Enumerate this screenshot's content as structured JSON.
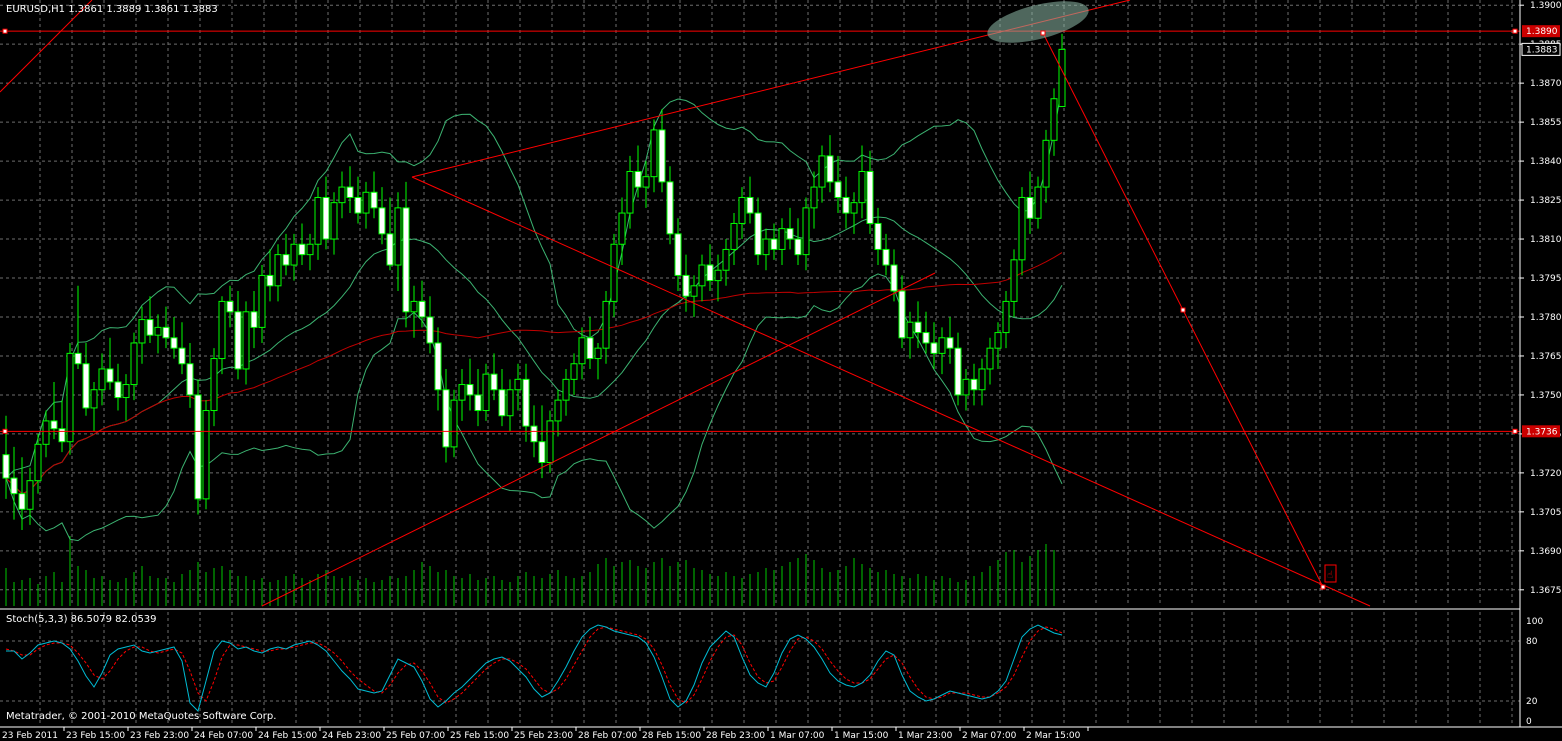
{
  "header": {
    "symbol_info": "EURUSD,H1  1.3861 1.3889 1.3861 1.3883"
  },
  "indicator": {
    "label": "Stoch(5,3,3) 86.5079 82.0539"
  },
  "footer": {
    "copyright": "Metatrader, © 2001-2010 MetaQuotes Software Corp."
  },
  "colors": {
    "background": "#000000",
    "grid": "#6e6e6e",
    "candle_up": "#000000",
    "candle_down": "#ffffff",
    "wick": "#00ff00",
    "bands": "#3cb371",
    "ma": "#c00000",
    "trendline": "#ff0000",
    "stoch_main": "#00bcd4",
    "stoch_signal": "#ff0000",
    "label_highlight": "#cc0000"
  },
  "price_axis": {
    "ticks": [
      "1.3900",
      "1.3885",
      "1.3870",
      "1.3855",
      "1.3840",
      "1.3825",
      "1.3810",
      "1.3795",
      "1.3780",
      "1.3765",
      "1.3750",
      "1.3735",
      "1.3720",
      "1.3705",
      "1.3690",
      "1.3675"
    ],
    "current_price_label": "1.3883",
    "hline_upper_label": "1.3890",
    "hline_lower_label": "1.3736"
  },
  "stoch_axis": {
    "ticks": [
      "100",
      "80",
      "20",
      "0"
    ]
  },
  "time_axis": {
    "labels": [
      "23 Feb 2011",
      "23 Feb 15:00",
      "23 Feb 23:00",
      "24 Feb 07:00",
      "24 Feb 15:00",
      "24 Feb 23:00",
      "25 Feb 07:00",
      "25 Feb 15:00",
      "25 Feb 23:00",
      "28 Feb 07:00",
      "28 Feb 15:00",
      "28 Feb 23:00",
      "1 Mar 07:00",
      "1 Mar 15:00",
      "1 Mar 23:00",
      "2 Mar 07:00",
      "2 Mar 15:00"
    ]
  },
  "chart_data": {
    "type": "candlestick",
    "symbol": "EURUSD",
    "timeframe": "H1",
    "last": {
      "open": 1.3861,
      "high": 1.3889,
      "low": 1.3861,
      "close": 1.3883
    },
    "ylim": [
      1.3668,
      1.3902
    ],
    "horizontal_lines": [
      1.389,
      1.3736
    ],
    "candles": [
      [
        1.3727,
        1.3742,
        1.371,
        1.3718
      ],
      [
        1.3718,
        1.373,
        1.3702,
        1.3712
      ],
      [
        1.3712,
        1.3726,
        1.3698,
        1.3706
      ],
      [
        1.3706,
        1.3722,
        1.37,
        1.3717
      ],
      [
        1.3717,
        1.3735,
        1.3712,
        1.3731
      ],
      [
        1.3731,
        1.3744,
        1.3726,
        1.374
      ],
      [
        1.374,
        1.3755,
        1.3733,
        1.3737
      ],
      [
        1.3737,
        1.3748,
        1.3728,
        1.3732
      ],
      [
        1.3732,
        1.377,
        1.3727,
        1.3766
      ],
      [
        1.3766,
        1.3792,
        1.376,
        1.3762
      ],
      [
        1.3762,
        1.377,
        1.3742,
        1.3745
      ],
      [
        1.3745,
        1.3755,
        1.3736,
        1.3752
      ],
      [
        1.3752,
        1.3766,
        1.3746,
        1.376
      ],
      [
        1.376,
        1.3772,
        1.3752,
        1.3755
      ],
      [
        1.3755,
        1.3762,
        1.3744,
        1.3749
      ],
      [
        1.3749,
        1.3758,
        1.374,
        1.3754
      ],
      [
        1.3754,
        1.3774,
        1.3748,
        1.377
      ],
      [
        1.377,
        1.3784,
        1.3762,
        1.3779
      ],
      [
        1.3779,
        1.3788,
        1.377,
        1.3773
      ],
      [
        1.3773,
        1.3781,
        1.3766,
        1.3776
      ],
      [
        1.3776,
        1.3784,
        1.3768,
        1.3772
      ],
      [
        1.3772,
        1.378,
        1.3764,
        1.3768
      ],
      [
        1.3768,
        1.3778,
        1.3758,
        1.3762
      ],
      [
        1.3762,
        1.377,
        1.3745,
        1.375
      ],
      [
        1.375,
        1.3756,
        1.3704,
        1.371
      ],
      [
        1.371,
        1.3748,
        1.3706,
        1.3744
      ],
      [
        1.3744,
        1.3768,
        1.3738,
        1.3764
      ],
      [
        1.3764,
        1.3788,
        1.3758,
        1.3786
      ],
      [
        1.3786,
        1.3792,
        1.3776,
        1.3782
      ],
      [
        1.3782,
        1.379,
        1.3756,
        1.376
      ],
      [
        1.376,
        1.3786,
        1.3754,
        1.3782
      ],
      [
        1.3782,
        1.379,
        1.3768,
        1.3776
      ],
      [
        1.3776,
        1.38,
        1.377,
        1.3796
      ],
      [
        1.3796,
        1.3806,
        1.3786,
        1.3792
      ],
      [
        1.3792,
        1.3808,
        1.3786,
        1.3804
      ],
      [
        1.3804,
        1.3812,
        1.3796,
        1.38
      ],
      [
        1.38,
        1.3812,
        1.3794,
        1.3808
      ],
      [
        1.3808,
        1.3816,
        1.38,
        1.3804
      ],
      [
        1.3804,
        1.3812,
        1.3798,
        1.3808
      ],
      [
        1.3808,
        1.383,
        1.3802,
        1.3826
      ],
      [
        1.3826,
        1.3834,
        1.3806,
        1.381
      ],
      [
        1.381,
        1.3828,
        1.3804,
        1.3824
      ],
      [
        1.3824,
        1.3836,
        1.3818,
        1.383
      ],
      [
        1.383,
        1.3838,
        1.382,
        1.3826
      ],
      [
        1.3826,
        1.3834,
        1.3816,
        1.382
      ],
      [
        1.382,
        1.3832,
        1.3814,
        1.3828
      ],
      [
        1.3828,
        1.3836,
        1.3818,
        1.3822
      ],
      [
        1.3822,
        1.383,
        1.3808,
        1.3812
      ],
      [
        1.3812,
        1.3826,
        1.3798,
        1.38
      ],
      [
        1.38,
        1.3828,
        1.379,
        1.3822
      ],
      [
        1.3822,
        1.3832,
        1.3776,
        1.3782
      ],
      [
        1.3782,
        1.3792,
        1.3772,
        1.3786
      ],
      [
        1.3786,
        1.3794,
        1.3776,
        1.378
      ],
      [
        1.378,
        1.3788,
        1.3766,
        1.377
      ],
      [
        1.377,
        1.3776,
        1.3744,
        1.3752
      ],
      [
        1.3752,
        1.376,
        1.3724,
        1.373
      ],
      [
        1.373,
        1.3752,
        1.3726,
        1.3748
      ],
      [
        1.3748,
        1.376,
        1.374,
        1.3754
      ],
      [
        1.3754,
        1.3764,
        1.3744,
        1.375
      ],
      [
        1.375,
        1.376,
        1.3738,
        1.3744
      ],
      [
        1.3744,
        1.3762,
        1.374,
        1.3758
      ],
      [
        1.3758,
        1.3766,
        1.3748,
        1.3752
      ],
      [
        1.3752,
        1.376,
        1.3738,
        1.3742
      ],
      [
        1.3742,
        1.3756,
        1.3736,
        1.3752
      ],
      [
        1.3752,
        1.3762,
        1.3744,
        1.3756
      ],
      [
        1.3756,
        1.3762,
        1.3732,
        1.3738
      ],
      [
        1.3738,
        1.3746,
        1.3726,
        1.3732
      ],
      [
        1.3732,
        1.3746,
        1.3718,
        1.3724
      ],
      [
        1.3724,
        1.3744,
        1.372,
        1.374
      ],
      [
        1.374,
        1.3752,
        1.3734,
        1.3748
      ],
      [
        1.3748,
        1.376,
        1.3742,
        1.3756
      ],
      [
        1.3756,
        1.3766,
        1.375,
        1.3762
      ],
      [
        1.3762,
        1.3776,
        1.3756,
        1.3772
      ],
      [
        1.3772,
        1.378,
        1.376,
        1.3764
      ],
      [
        1.3764,
        1.377,
        1.3756,
        1.3768
      ],
      [
        1.3768,
        1.379,
        1.3762,
        1.3786
      ],
      [
        1.3786,
        1.3812,
        1.378,
        1.3808
      ],
      [
        1.3808,
        1.3826,
        1.38,
        1.382
      ],
      [
        1.382,
        1.3842,
        1.3814,
        1.3836
      ],
      [
        1.3836,
        1.3846,
        1.3826,
        1.383
      ],
      [
        1.383,
        1.384,
        1.3822,
        1.3834
      ],
      [
        1.3834,
        1.3856,
        1.3828,
        1.3852
      ],
      [
        1.3852,
        1.386,
        1.3828,
        1.3832
      ],
      [
        1.3832,
        1.3838,
        1.3808,
        1.3812
      ],
      [
        1.3812,
        1.3818,
        1.379,
        1.3796
      ],
      [
        1.3796,
        1.3804,
        1.3782,
        1.3788
      ],
      [
        1.3788,
        1.3796,
        1.378,
        1.3792
      ],
      [
        1.3792,
        1.3804,
        1.3786,
        1.38
      ],
      [
        1.38,
        1.3808,
        1.379,
        1.3794
      ],
      [
        1.3794,
        1.3804,
        1.3786,
        1.3798
      ],
      [
        1.3798,
        1.381,
        1.3792,
        1.3806
      ],
      [
        1.3806,
        1.382,
        1.38,
        1.3816
      ],
      [
        1.3816,
        1.383,
        1.381,
        1.3826
      ],
      [
        1.3826,
        1.3834,
        1.3816,
        1.382
      ],
      [
        1.382,
        1.3826,
        1.38,
        1.3804
      ],
      [
        1.3804,
        1.3814,
        1.3798,
        1.381
      ],
      [
        1.381,
        1.3816,
        1.3802,
        1.3806
      ],
      [
        1.3806,
        1.3818,
        1.38,
        1.3814
      ],
      [
        1.3814,
        1.3822,
        1.3806,
        1.381
      ],
      [
        1.381,
        1.3818,
        1.38,
        1.3804
      ],
      [
        1.3804,
        1.3826,
        1.3798,
        1.3822
      ],
      [
        1.3822,
        1.3836,
        1.3814,
        1.383
      ],
      [
        1.383,
        1.3846,
        1.3824,
        1.3842
      ],
      [
        1.3842,
        1.385,
        1.3828,
        1.3832
      ],
      [
        1.3832,
        1.3842,
        1.382,
        1.3826
      ],
      [
        1.3826,
        1.3834,
        1.3814,
        1.382
      ],
      [
        1.382,
        1.3828,
        1.3812,
        1.3824
      ],
      [
        1.3824,
        1.3846,
        1.3818,
        1.3836
      ],
      [
        1.3836,
        1.3844,
        1.3812,
        1.3816
      ],
      [
        1.3816,
        1.3822,
        1.38,
        1.3806
      ],
      [
        1.3806,
        1.3812,
        1.3796,
        1.38
      ],
      [
        1.38,
        1.3806,
        1.3786,
        1.379
      ],
      [
        1.379,
        1.3796,
        1.3768,
        1.3772
      ],
      [
        1.3772,
        1.3782,
        1.3764,
        1.3778
      ],
      [
        1.3778,
        1.3786,
        1.3768,
        1.3774
      ],
      [
        1.3774,
        1.3782,
        1.3766,
        1.377
      ],
      [
        1.377,
        1.3778,
        1.376,
        1.3766
      ],
      [
        1.3766,
        1.3776,
        1.3758,
        1.3772
      ],
      [
        1.3772,
        1.378,
        1.3762,
        1.3768
      ],
      [
        1.3768,
        1.3774,
        1.3746,
        1.375
      ],
      [
        1.375,
        1.376,
        1.3744,
        1.3756
      ],
      [
        1.3756,
        1.3762,
        1.3746,
        1.3752
      ],
      [
        1.3752,
        1.3764,
        1.3746,
        1.376
      ],
      [
        1.376,
        1.3772,
        1.3754,
        1.3768
      ],
      [
        1.3768,
        1.3778,
        1.376,
        1.3774
      ],
      [
        1.3774,
        1.379,
        1.3768,
        1.3786
      ],
      [
        1.3786,
        1.3806,
        1.378,
        1.3802
      ],
      [
        1.3802,
        1.383,
        1.3796,
        1.3826
      ],
      [
        1.3826,
        1.3836,
        1.3812,
        1.3818
      ],
      [
        1.3818,
        1.3834,
        1.3814,
        1.383
      ],
      [
        1.383,
        1.3852,
        1.3824,
        1.3848
      ],
      [
        1.3848,
        1.3868,
        1.3842,
        1.3864
      ],
      [
        1.3861,
        1.3889,
        1.3861,
        1.3883
      ]
    ],
    "volume": [
      38,
      24,
      26,
      28,
      22,
      30,
      34,
      24,
      70,
      40,
      36,
      28,
      30,
      26,
      24,
      28,
      34,
      40,
      30,
      28,
      28,
      24,
      32,
      36,
      44,
      34,
      38,
      40,
      36,
      30,
      30,
      26,
      28,
      24,
      26,
      30,
      32,
      28,
      26,
      32,
      36,
      30,
      28,
      30,
      26,
      28,
      24,
      26,
      30,
      28,
      30,
      36,
      44,
      40,
      34,
      36,
      30,
      28,
      32,
      26,
      28,
      30,
      26,
      24,
      30,
      34,
      30,
      28,
      32,
      36,
      30,
      28,
      30,
      34,
      42,
      48,
      40,
      44,
      46,
      40,
      38,
      44,
      48,
      40,
      44,
      46,
      38,
      36,
      32,
      30,
      34,
      30,
      28,
      32,
      34,
      38,
      36,
      40,
      44,
      48,
      52,
      46,
      38,
      34,
      36,
      40,
      48,
      42,
      38,
      34,
      36,
      32,
      30,
      28,
      32,
      30,
      26,
      30,
      28,
      24,
      26,
      30,
      34,
      40,
      46,
      54,
      56,
      44,
      50,
      56,
      62,
      56
    ],
    "stoch_main": [
      70,
      70,
      62,
      68,
      76,
      78,
      80,
      78,
      72,
      60,
      45,
      34,
      48,
      66,
      72,
      74,
      76,
      70,
      68,
      70,
      72,
      74,
      60,
      18,
      10,
      40,
      70,
      80,
      78,
      72,
      74,
      70,
      68,
      72,
      74,
      72,
      76,
      78,
      80,
      76,
      70,
      60,
      50,
      42,
      32,
      30,
      28,
      30,
      46,
      62,
      58,
      54,
      40,
      22,
      14,
      20,
      28,
      34,
      42,
      50,
      58,
      62,
      64,
      60,
      52,
      44,
      32,
      24,
      28,
      40,
      54,
      70,
      84,
      92,
      96,
      94,
      90,
      88,
      86,
      84,
      78,
      64,
      44,
      22,
      14,
      20,
      36,
      58,
      74,
      82,
      90,
      84,
      64,
      46,
      38,
      34,
      48,
      68,
      82,
      86,
      82,
      74,
      62,
      48,
      40,
      36,
      34,
      38,
      46,
      60,
      70,
      66,
      46,
      30,
      24,
      20,
      22,
      26,
      30,
      28,
      26,
      24,
      22,
      24,
      30,
      40,
      62,
      84,
      92,
      96,
      92,
      88,
      86
    ],
    "stoch_signal": [
      72,
      70,
      66,
      66,
      72,
      76,
      78,
      78,
      76,
      68,
      58,
      46,
      42,
      50,
      62,
      70,
      74,
      74,
      70,
      68,
      70,
      72,
      68,
      50,
      28,
      20,
      40,
      64,
      76,
      76,
      74,
      72,
      70,
      70,
      72,
      72,
      74,
      76,
      78,
      78,
      74,
      68,
      60,
      50,
      42,
      36,
      30,
      28,
      36,
      48,
      56,
      58,
      50,
      38,
      24,
      18,
      22,
      28,
      36,
      44,
      52,
      58,
      62,
      62,
      58,
      52,
      42,
      32,
      28,
      32,
      42,
      56,
      70,
      84,
      92,
      94,
      92,
      90,
      88,
      86,
      82,
      72,
      56,
      36,
      22,
      18,
      26,
      42,
      60,
      74,
      84,
      86,
      76,
      58,
      44,
      38,
      40,
      54,
      70,
      82,
      84,
      80,
      72,
      60,
      50,
      42,
      38,
      38,
      42,
      52,
      62,
      66,
      58,
      44,
      32,
      24,
      22,
      24,
      28,
      28,
      28,
      26,
      24,
      24,
      28,
      34,
      46,
      64,
      80,
      90,
      94,
      92,
      88
    ]
  }
}
